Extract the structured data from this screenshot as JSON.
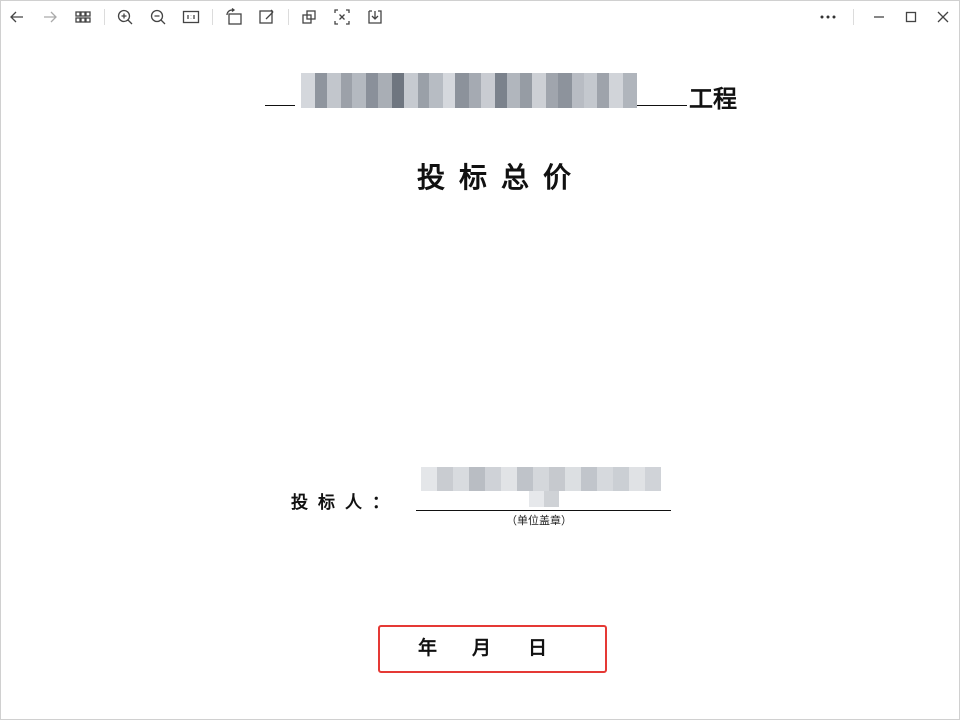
{
  "toolbar": {
    "left_icons": [
      "back-icon",
      "forward-icon",
      "grid-icon",
      "zoom-in-icon",
      "zoom-out-icon",
      "actual-size-icon",
      "rotate-icon",
      "edit-icon",
      "crop-icon",
      "fit-icon",
      "download-icon"
    ],
    "right_icons": [
      "more-icon",
      "minimize-icon",
      "maximize-icon",
      "close-icon"
    ]
  },
  "document": {
    "project_suffix": "工程",
    "title": "投标总价",
    "bidder_label": "投标人：",
    "stamp_note": "（单位盖章）",
    "date": {
      "year": "年",
      "month": "月",
      "day": "日"
    }
  },
  "colors": {
    "highlight_box": "#e53935",
    "redaction": [
      "#9aa0a8",
      "#c8ccd2",
      "#7e858f",
      "#b9bec6",
      "#d8dbe0"
    ]
  }
}
